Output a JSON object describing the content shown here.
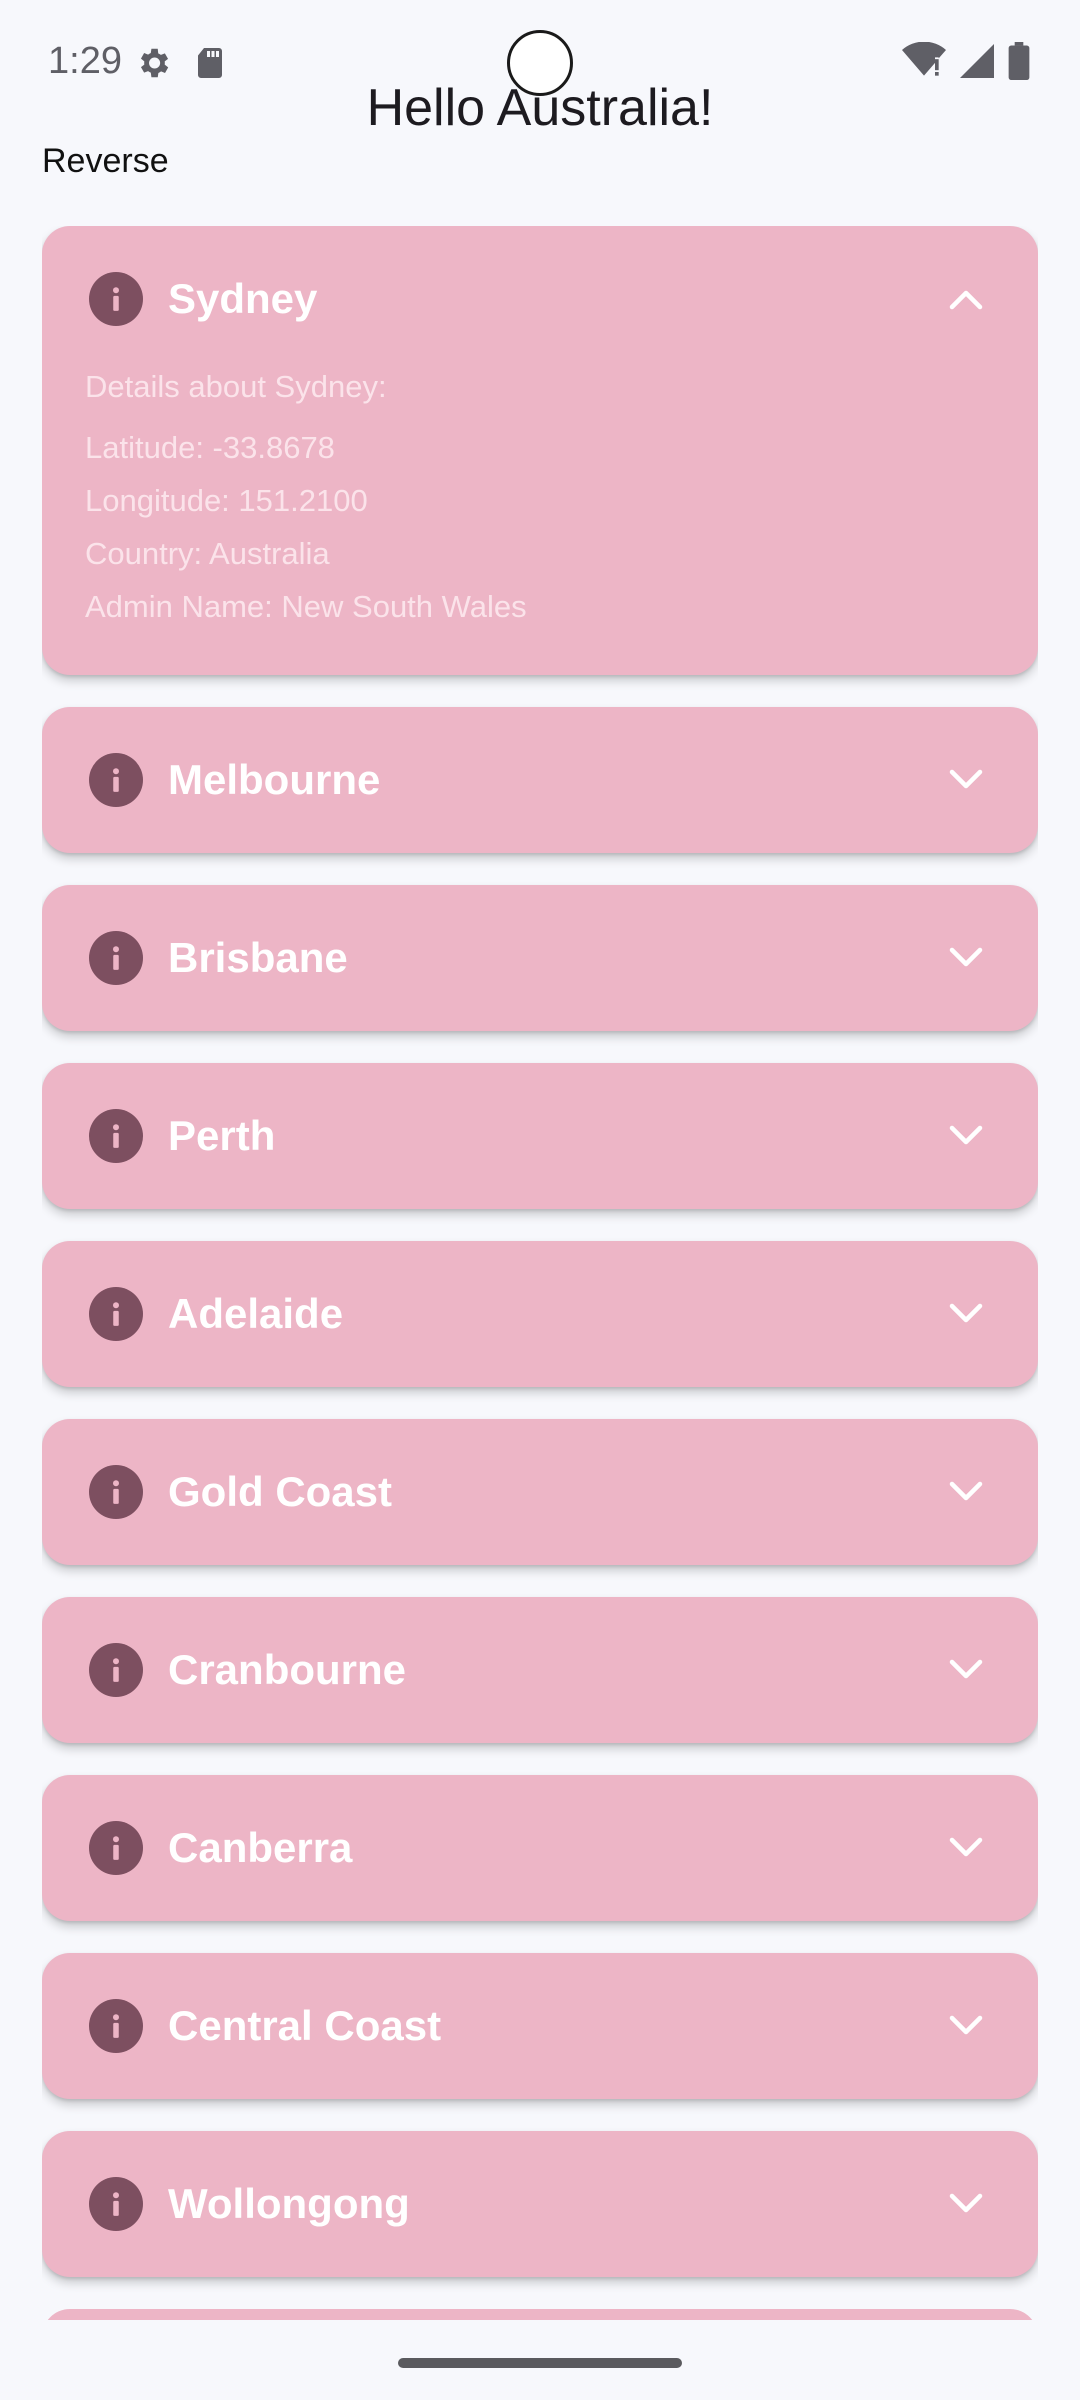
{
  "status_bar": {
    "time": "1:29",
    "left_icons": [
      "settings-gear-icon",
      "sd-card-icon"
    ],
    "right_icons": [
      "wifi-alert-icon",
      "cellular-signal-icon",
      "battery-icon"
    ]
  },
  "header": {
    "title": "Hello Australia!",
    "reverse_label": "Reverse"
  },
  "colors": {
    "card_background": "#edb5c6",
    "icon_color": "#7d4f60",
    "title_color": "#ffffff",
    "detail_text_color": "#fbe3ea",
    "page_background": "#f7f8fc"
  },
  "cities": [
    {
      "name": "Sydney",
      "expanded": true,
      "details_heading": "Details about Sydney:",
      "latitude": "Latitude: -33.8678",
      "longitude": "Longitude: 151.2100",
      "country": "Country: Australia",
      "admin_name": "Admin Name: New South Wales"
    },
    {
      "name": "Melbourne",
      "expanded": false
    },
    {
      "name": "Brisbane",
      "expanded": false
    },
    {
      "name": "Perth",
      "expanded": false
    },
    {
      "name": "Adelaide",
      "expanded": false
    },
    {
      "name": "Gold Coast",
      "expanded": false
    },
    {
      "name": "Cranbourne",
      "expanded": false
    },
    {
      "name": "Canberra",
      "expanded": false
    },
    {
      "name": "Central Coast",
      "expanded": false
    },
    {
      "name": "Wollongong",
      "expanded": false
    }
  ]
}
